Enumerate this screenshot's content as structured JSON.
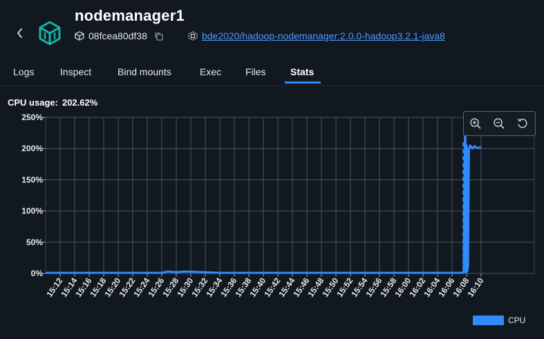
{
  "header": {
    "title": "nodemanager1",
    "container_id": "08fcea80df38",
    "image_link": "bde2020/hadoop-nodemanager:2.0.0-hadoop3.2.1-java8"
  },
  "tabs": [
    {
      "label": "Logs",
      "active": false
    },
    {
      "label": "Inspect",
      "active": false
    },
    {
      "label": "Bind mounts",
      "active": false
    },
    {
      "label": "Exec",
      "active": false
    },
    {
      "label": "Files",
      "active": false
    },
    {
      "label": "Stats",
      "active": true
    }
  ],
  "stats": {
    "label": "CPU usage:",
    "value": "202.62%"
  },
  "colors": {
    "accent": "#2f8cff",
    "background": "#111820",
    "link": "#4f9bff"
  },
  "zoom_controls": [
    "zoom-in-icon",
    "zoom-out-icon",
    "reset-icon"
  ],
  "chart_data": {
    "type": "line",
    "title": "",
    "xlabel": "",
    "ylabel": "",
    "ylim": [
      0,
      250
    ],
    "y_ticks": [
      "0%",
      "50%",
      "100%",
      "150%",
      "200%",
      "250%"
    ],
    "x_ticks": [
      "15:12",
      "15:14",
      "15:16",
      "15:18",
      "15:20",
      "15:22",
      "15:24",
      "15:26",
      "15:28",
      "15:30",
      "15:32",
      "15:34",
      "15:36",
      "15:38",
      "15:40",
      "15:42",
      "15:44",
      "15:46",
      "15:48",
      "15:50",
      "15:52",
      "15:54",
      "15:56",
      "15:58",
      "16:00",
      "16:02",
      "16:04",
      "16:06",
      "16:08",
      "16:10"
    ],
    "grid": true,
    "legend_position": "bottom-right",
    "series": [
      {
        "name": "CPU",
        "color": "#2f8cff",
        "x": [
          15.2,
          15.4,
          15.467,
          15.48,
          15.5,
          15.52,
          15.6,
          15.8,
          16.0,
          16.15,
          16.16,
          16.163,
          16.165,
          16.167,
          16.168,
          16.17,
          16.172,
          16.175,
          16.18,
          16.185,
          16.19,
          16.2
        ],
        "y": [
          1,
          1,
          1,
          3,
          2,
          3,
          1,
          1,
          1,
          1,
          1,
          225,
          2,
          205,
          3,
          12,
          200,
          205,
          200,
          204,
          201,
          202
        ]
      }
    ]
  }
}
